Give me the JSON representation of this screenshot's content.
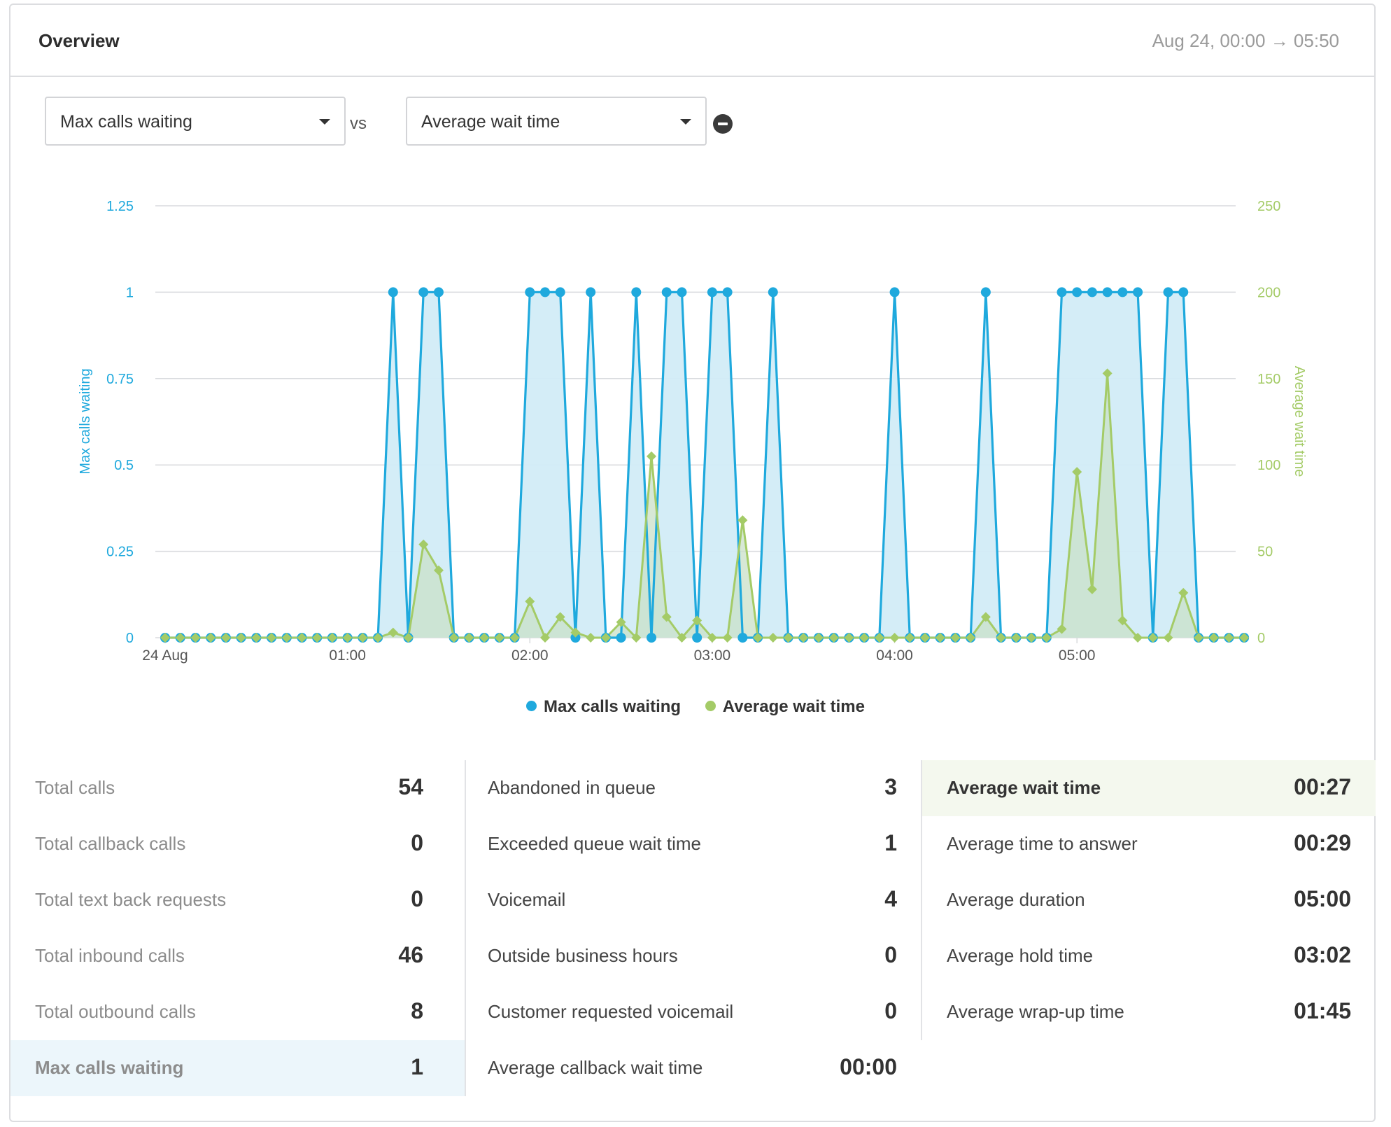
{
  "header": {
    "title": "Overview",
    "date_range": "Aug 24, 00:00 → 05:50"
  },
  "controls": {
    "primary_metric": "Max calls waiting",
    "vs_label": "vs",
    "secondary_metric": "Average wait time",
    "remove_icon": "minus-circle-icon"
  },
  "colors": {
    "primary": "#1fa9dd",
    "primary_fill": "#d2ecf7",
    "secondary": "#a4cb67",
    "secondary_fill": "#c9e0c8",
    "grid": "#d8dadd"
  },
  "chart_data": {
    "type": "line",
    "x_interval_minutes": 5,
    "x_start": "24 Aug 00:00",
    "x_end": "24 Aug 05:50",
    "x_tick_labels": [
      "24 Aug",
      "01:00",
      "02:00",
      "03:00",
      "04:00",
      "05:00"
    ],
    "y_left": {
      "label": "Max calls waiting",
      "ticks": [
        "0",
        "0.25",
        "0.5",
        "0.75",
        "1",
        "1.25"
      ],
      "range": [
        0,
        1.25
      ]
    },
    "y_right": {
      "label": "Average wait time",
      "ticks": [
        "0",
        "50",
        "100",
        "150",
        "200",
        "250"
      ],
      "range": [
        0,
        250
      ]
    },
    "grid": true,
    "legend_position": "bottom",
    "series": [
      {
        "name": "Max calls waiting",
        "axis": "left",
        "marker": "circle",
        "area": true,
        "values": [
          0,
          0,
          0,
          0,
          0,
          0,
          0,
          0,
          0,
          0,
          0,
          0,
          0,
          0,
          0,
          1,
          0,
          1,
          1,
          0,
          0,
          0,
          0,
          0,
          1,
          1,
          1,
          0,
          1,
          0,
          0,
          1,
          0,
          1,
          1,
          0,
          1,
          1,
          0,
          0,
          1,
          0,
          0,
          0,
          0,
          0,
          0,
          0,
          1,
          0,
          0,
          0,
          0,
          0,
          1,
          0,
          0,
          0,
          0,
          1,
          1,
          1,
          1,
          1,
          1,
          0,
          1,
          1,
          0,
          0,
          0,
          0
        ]
      },
      {
        "name": "Average wait time",
        "axis": "right",
        "marker": "diamond",
        "area": true,
        "values": [
          0,
          0,
          0,
          0,
          0,
          0,
          0,
          0,
          0,
          0,
          0,
          0,
          0,
          0,
          0,
          3,
          0,
          54,
          39,
          0,
          0,
          0,
          0,
          0,
          21,
          0,
          12,
          3,
          0,
          0,
          9,
          0,
          105,
          12,
          0,
          10,
          0,
          0,
          68,
          0,
          0,
          0,
          0,
          0,
          0,
          0,
          0,
          0,
          0,
          0,
          0,
          0,
          0,
          0,
          12,
          0,
          0,
          0,
          0,
          5,
          96,
          28,
          153,
          10,
          0,
          0,
          0,
          26,
          0,
          0,
          0,
          0
        ]
      }
    ]
  },
  "stats": {
    "col1": [
      {
        "label": "Total calls",
        "value": "54"
      },
      {
        "label": "Total callback calls",
        "value": "0"
      },
      {
        "label": "Total text back requests",
        "value": "0"
      },
      {
        "label": "Total inbound calls",
        "value": "46"
      },
      {
        "label": "Total outbound calls",
        "value": "8"
      },
      {
        "label": "Max calls waiting",
        "value": "1"
      }
    ],
    "col2": [
      {
        "label": "Abandoned in queue",
        "value": "3"
      },
      {
        "label": "Exceeded queue wait time",
        "value": "1"
      },
      {
        "label": "Voicemail",
        "value": "4"
      },
      {
        "label": "Outside business hours",
        "value": "0"
      },
      {
        "label": "Customer requested voicemail",
        "value": "0"
      },
      {
        "label": "Average callback wait time",
        "value": "00:00"
      }
    ],
    "col3": [
      {
        "label": "Average wait time",
        "value": "00:27"
      },
      {
        "label": "Average time to answer",
        "value": "00:29"
      },
      {
        "label": "Average duration",
        "value": "05:00"
      },
      {
        "label": "Average hold time",
        "value": "03:02"
      },
      {
        "label": "Average wrap-up time",
        "value": "01:45"
      }
    ]
  }
}
